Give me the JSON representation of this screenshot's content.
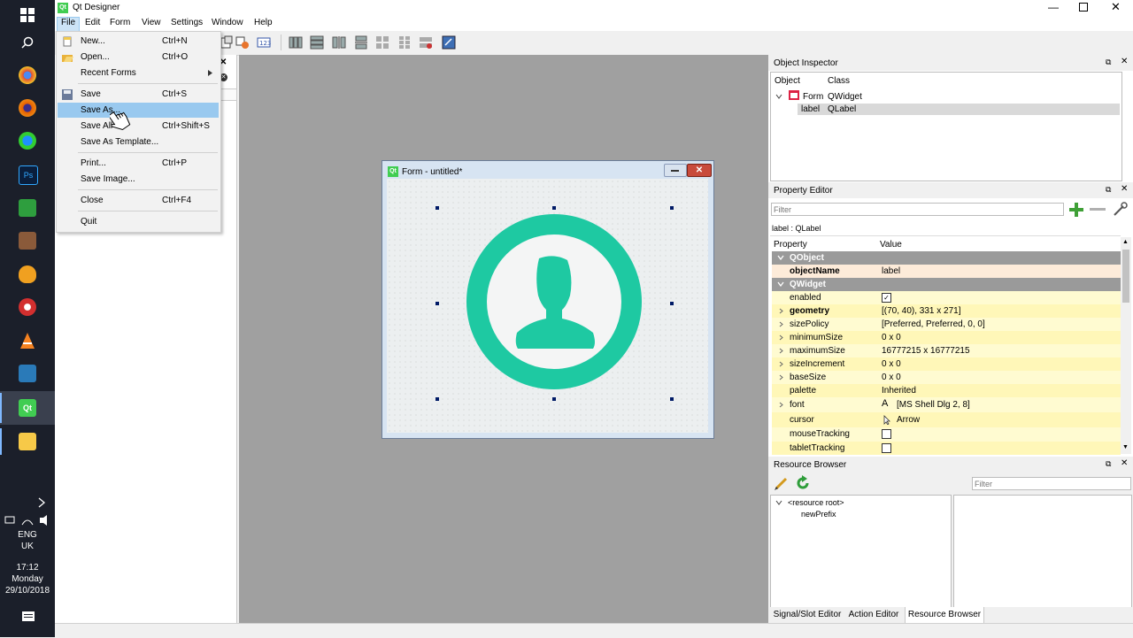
{
  "window": {
    "title": "Qt Designer"
  },
  "menubar": [
    "File",
    "Edit",
    "Form",
    "View",
    "Settings",
    "Window",
    "Help"
  ],
  "file_menu": [
    {
      "label": "New...",
      "shortcut": "Ctrl+N"
    },
    {
      "label": "Open...",
      "shortcut": "Ctrl+O"
    },
    {
      "label": "Recent Forms",
      "shortcut": ""
    },
    {
      "label": "Save",
      "shortcut": "Ctrl+S"
    },
    {
      "label": "Save As...",
      "shortcut": ""
    },
    {
      "label": "Save All",
      "shortcut": "Ctrl+Shift+S"
    },
    {
      "label": "Save As Template...",
      "shortcut": ""
    },
    {
      "label": "Print...",
      "shortcut": "Ctrl+P"
    },
    {
      "label": "Save Image...",
      "shortcut": ""
    },
    {
      "label": "Close",
      "shortcut": "Ctrl+F4"
    },
    {
      "label": "Quit",
      "shortcut": ""
    }
  ],
  "form": {
    "title": "Form - untitled*"
  },
  "object_inspector": {
    "title": "Object Inspector",
    "headers": [
      "Object",
      "Class"
    ],
    "rows": [
      {
        "object": "Form",
        "class": "QWidget"
      },
      {
        "object": "label",
        "class": "QLabel"
      }
    ]
  },
  "property_editor": {
    "title": "Property Editor",
    "filter_placeholder": "Filter",
    "context": "label : QLabel",
    "headers": [
      "Property",
      "Value"
    ],
    "rows": [
      {
        "name": "QObject",
        "value": "",
        "type": "group"
      },
      {
        "name": "objectName",
        "value": "label",
        "type": "bold"
      },
      {
        "name": "QWidget",
        "value": "",
        "type": "group"
      },
      {
        "name": "enabled",
        "value": "",
        "type": "check",
        "checked": true
      },
      {
        "name": "geometry",
        "value": "[(70, 40), 331 x 271]",
        "type": "bold"
      },
      {
        "name": "sizePolicy",
        "value": "[Preferred, Preferred, 0, 0]",
        "type": "normal"
      },
      {
        "name": "minimumSize",
        "value": "0 x 0",
        "type": "normal"
      },
      {
        "name": "maximumSize",
        "value": "16777215 x 16777215",
        "type": "normal"
      },
      {
        "name": "sizeIncrement",
        "value": "0 x 0",
        "type": "normal"
      },
      {
        "name": "baseSize",
        "value": "0 x 0",
        "type": "normal"
      },
      {
        "name": "palette",
        "value": "Inherited",
        "type": "normal"
      },
      {
        "name": "font",
        "value": "[MS Shell Dlg 2, 8]",
        "type": "normal"
      },
      {
        "name": "cursor",
        "value": "Arrow",
        "type": "normal"
      },
      {
        "name": "mouseTracking",
        "value": "",
        "type": "check",
        "checked": false
      },
      {
        "name": "tabletTracking",
        "value": "",
        "type": "check",
        "checked": false
      }
    ]
  },
  "resource_browser": {
    "title": "Resource Browser",
    "filter_placeholder": "Filter",
    "tree": [
      "<resource root>",
      "newPrefix"
    ]
  },
  "bottom_tabs": [
    "Signal/Slot Editor",
    "Action Editor",
    "Resource Browser"
  ],
  "taskbar": {
    "lang": "ENG",
    "region": "UK",
    "time": "17:12",
    "day": "Monday",
    "date": "29/10/2018"
  }
}
